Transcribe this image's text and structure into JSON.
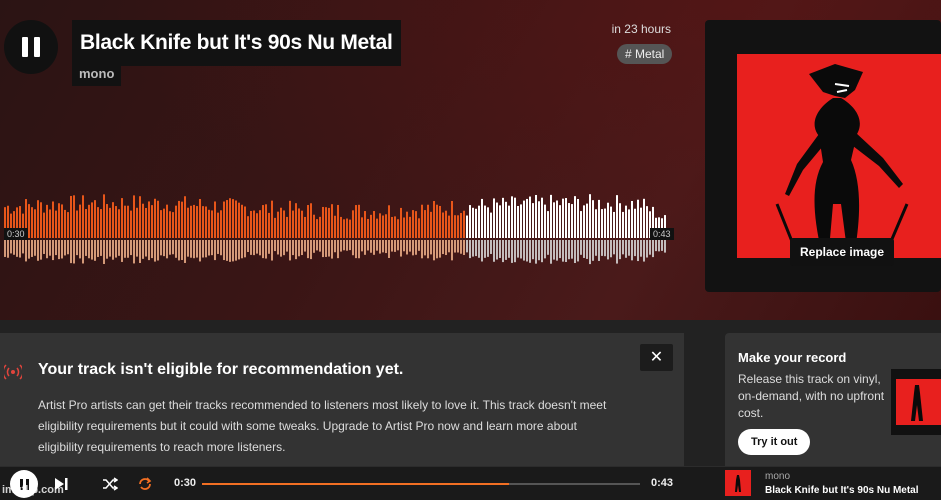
{
  "track": {
    "title": "Black Knife but It's 90s Nu Metal",
    "artist": "mono",
    "upload_time": "in 23 hours",
    "tag": "# Metal",
    "current_time": "0:30",
    "duration": "0:43",
    "progress_fraction": 0.7
  },
  "colors": {
    "accent": "#f26f23",
    "played_wave": "#e8561a",
    "unplayed_wave": "#ffffff",
    "art_red": "#e8201e"
  },
  "artwork": {
    "replace_label": "Replace image"
  },
  "notice": {
    "title": "Your track isn't eligible for recommendation yet.",
    "body": "Artist Pro artists can get their tracks recommended to listeners most likely to love it. This track doesn't meet eligibility requirements but it could with some tweaks. Upgrade to Artist Pro now and learn more about eligibility requirements to reach more listeners.",
    "close_label": "✕",
    "icon": "broadcast-icon"
  },
  "record": {
    "title": "Make your record",
    "body": "Release this track on vinyl, on-demand, with no upfront cost.",
    "cta": "Try it out"
  },
  "player": {
    "current_time": "0:30",
    "duration": "0:43",
    "artist": "mono",
    "title": "Black Knife but It's 90s Nu Metal",
    "icons": [
      "pause-icon",
      "skip-next-icon",
      "shuffle-icon",
      "repeat-icon"
    ]
  },
  "watermark": "imgflip.com"
}
